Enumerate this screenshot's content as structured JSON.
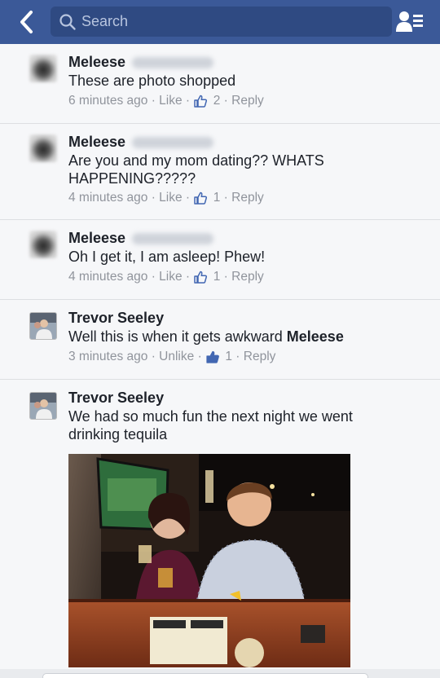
{
  "header": {
    "search_placeholder": "Search"
  },
  "comments": [
    {
      "name": "Meleese",
      "text": "These are photo shopped",
      "time": "6 minutes ago",
      "like": "Like",
      "likes": "2",
      "reply": "Reply"
    },
    {
      "name": "Meleese",
      "text": "Are you and my mom dating?? WHATS HAPPENING?????",
      "time": "4 minutes ago",
      "like": "Like",
      "likes": "1",
      "reply": "Reply"
    },
    {
      "name": "Meleese",
      "text": "Oh I get it, I am asleep! Phew!",
      "time": "4 minutes ago",
      "like": "Like",
      "likes": "1",
      "reply": "Reply"
    },
    {
      "name": "Trevor Seeley",
      "text": "Well this is when it gets awkward ",
      "mention": "Meleese",
      "time": "3 minutes ago",
      "like": "Unlike",
      "likes": "1",
      "reply": "Reply"
    },
    {
      "name": "Trevor Seeley",
      "text": "We had so much fun the next night we went drinking tequila"
    }
  ],
  "sep": "·",
  "colors": {
    "brand": "#3b5998",
    "like_active": "#4267b2",
    "meta": "#90949c"
  }
}
